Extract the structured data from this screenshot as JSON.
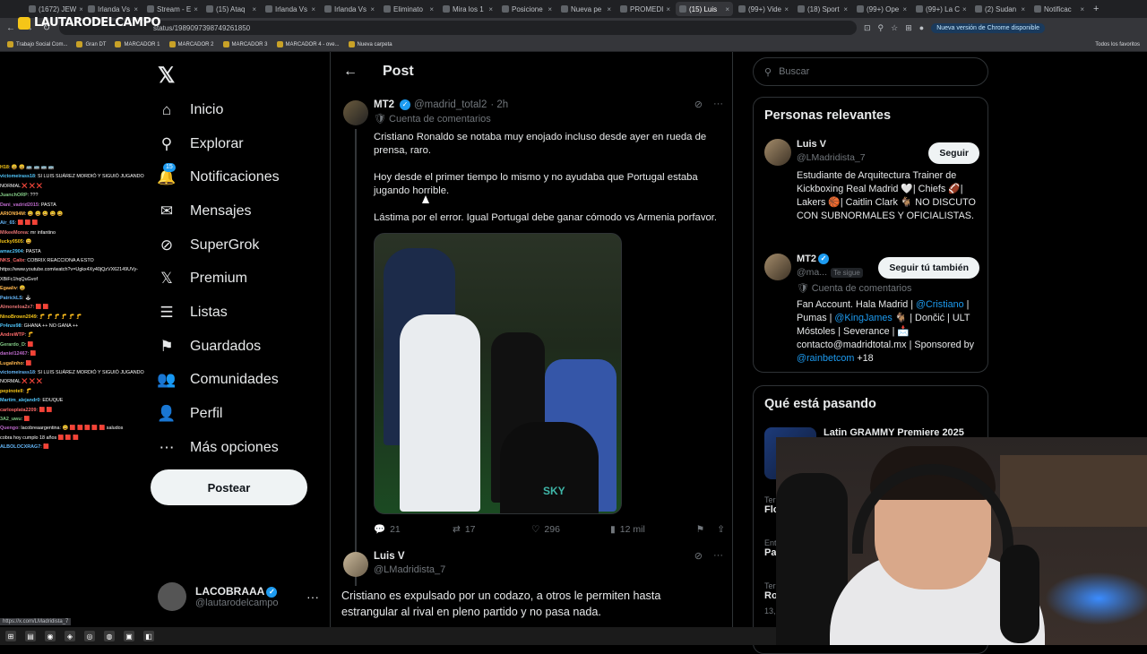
{
  "browser": {
    "tabs": [
      "(1672) JEW",
      "Irlanda Vs",
      "Stream - E",
      "(15) Ataq",
      "Irlanda Vs",
      "Irlanda Vs",
      "Eliminato",
      "Mira los 1",
      "Posicione",
      "Nueva pe",
      "PROMEDI",
      "(15) Luis",
      "(99+) Vide",
      "(18) Sport",
      "(99+) Ope",
      "(99+) La C",
      "(2) Sudan",
      "Notificac"
    ],
    "active_tab_index": 11,
    "url": "status/1989097398749261850",
    "update_label": "Nueva versión de Chrome disponible",
    "bookmarks": [
      "Trabajo Social Com...",
      "Gran DT",
      "MARCADOR 1",
      "MARCADOR 2",
      "MARCADOR 3",
      "MARCADOR 4 - ove...",
      "Nueva carpeta"
    ],
    "all_bookmarks": "Todos los favoritos",
    "status_url": "https://x.com/LMadridista_7"
  },
  "stream": {
    "logo": "LAUTARODELCAMPO",
    "chat": [
      {
        "user": "H18",
        "msg": ": 😀 😀 🚌 🚌 🚌 🚌"
      },
      {
        "user": "victomeirass18",
        "msg": ": SI LUIS SUÁREZ MORDIÓ Y SIGUIÓ JUGANDO"
      },
      {
        "user": "",
        "msg": "NORMAL ❌ ❌ ❌"
      },
      {
        "user": "JuanchORP",
        "msg": ": ???"
      },
      {
        "user": "Dani_vadrid2015",
        "msg": ": PASTA"
      },
      {
        "user": "ARION94M",
        "msg": ": 😀 😀 😀 😀 😀"
      },
      {
        "user": "Air_65",
        "msg": ": 🟥 🟥 🟥"
      },
      {
        "user": "MikeeMorea",
        "msg": ": mr infantino"
      },
      {
        "user": "lucky0505",
        "msg": ": 😀"
      },
      {
        "user": "amac2904",
        "msg": ": PASTA"
      },
      {
        "user": "NKS_Calix",
        "msg": ": COBRIX REACCIONA A ESTO"
      },
      {
        "user": "",
        "msg": "https://www.youtube.com/watch?v=Ugkx4Xy40jQzVX62149UVy-"
      },
      {
        "user": "",
        "msg": "XBiFc1hqQuGvof"
      },
      {
        "user": "Egaaliv",
        "msg": ": 😀"
      },
      {
        "user": "PatrickLS",
        "msg": ": 🕹"
      },
      {
        "user": "Almoneloa2x7",
        "msg": ": 🟥 🟥"
      },
      {
        "user": "NinoBrown2049",
        "msg": ": 🦵 🦵 🦵 🦵 🦵 🦵"
      },
      {
        "user": "Pr4nze98",
        "msg": ": GHANA ++ NO GANA ++"
      },
      {
        "user": "AndreWTP",
        "msg": ": 🦵"
      },
      {
        "user": "Gerardo_D",
        "msg": ": 🟥"
      },
      {
        "user": "daniel12467",
        "msg": ": 🟥"
      },
      {
        "user": "Lugalinho",
        "msg": ": 🟥"
      },
      {
        "user": "victomeirass18",
        "msg": ": SI LUIS SUÁREZ MORDIÓ Y SIGUIÓ JUGANDO"
      },
      {
        "user": "",
        "msg": "NORMAL ❌ ❌ ❌"
      },
      {
        "user": "pepinotell",
        "msg": ": 🦵"
      },
      {
        "user": "Martim_alejandr0",
        "msg": ": EDUQUE"
      },
      {
        "user": "carlosplata2209",
        "msg": ": 🟥 🟥"
      },
      {
        "user": "3A2_uwu",
        "msg": ": 🟥"
      },
      {
        "user": "Quengo",
        "msg": ": lacobreaargentina: 😀 🟥 🟥 🟥 🟥 🟥 saludos"
      },
      {
        "user": "",
        "msg": "cobra hoy cumplo 18 años 🟥 🟥 🟥"
      },
      {
        "user": "ALBOLOCXRAG7",
        "msg": ": 🟥"
      }
    ]
  },
  "sidebar": {
    "nav": [
      {
        "label": "Inicio",
        "icon": "home-icon",
        "glyph": "⌂"
      },
      {
        "label": "Explorar",
        "icon": "search-icon",
        "glyph": "⚲"
      },
      {
        "label": "Notificaciones",
        "icon": "bell-icon",
        "glyph": "🔔",
        "badge": "15"
      },
      {
        "label": "Mensajes",
        "icon": "mail-icon",
        "glyph": "✉"
      },
      {
        "label": "SuperGrok",
        "icon": "grok-icon",
        "glyph": "⊘"
      },
      {
        "label": "Premium",
        "icon": "x-premium-icon",
        "glyph": "𝕏"
      },
      {
        "label": "Listas",
        "icon": "list-icon",
        "glyph": "☰"
      },
      {
        "label": "Guardados",
        "icon": "bookmark-icon",
        "glyph": "⚑"
      },
      {
        "label": "Comunidades",
        "icon": "communities-icon",
        "glyph": "👥"
      },
      {
        "label": "Perfil",
        "icon": "profile-icon",
        "glyph": "👤"
      },
      {
        "label": "Más opciones",
        "icon": "more-circle-icon",
        "glyph": "⋯"
      }
    ],
    "post_button": "Postear",
    "account_name": "LACOBRAAA",
    "account_handle": "@lautarodelcampo"
  },
  "main": {
    "title": "Post",
    "tweet": {
      "name": "MT2",
      "handle": "@madrid_total2",
      "time": "· 2h",
      "sub": "Cuenta de comentarios",
      "paragraphs": [
        "Cristiano Ronaldo se notaba muy enojado incluso desde ayer en rueda de prensa, raro.",
        "Hoy desde el primer tiempo lo mismo y no ayudaba que Portugal estaba jugando horrible.",
        "Lástima por el error. Igual Portugal debe ganar cómodo vs Armenia porfavor."
      ],
      "image_label": "SKY",
      "replies": "21",
      "reposts": "17",
      "likes": "296",
      "views": "12 mil"
    },
    "reply": {
      "name": "Luis V",
      "handle": "@LMadridista_7",
      "text": "Cristiano es expulsado por un codazo, a otros le permiten hasta estrangular al rival en pleno partido y no pasa nada."
    }
  },
  "right": {
    "search_placeholder": "Buscar",
    "relevant_title": "Personas relevantes",
    "people": [
      {
        "name": "Luis V",
        "handle": "@LMadridista_7",
        "button": "Seguir",
        "bio": "Estudiante de Arquitectura Trainer de Kickboxing Real Madrid 🤍| Chiefs 🏈| Lakers 🏀| Caitlin Clark 🐐 NO DISCUTO CON SUBNORMALES Y OFICIALISTAS."
      },
      {
        "name": "MT2",
        "handle": "@ma...",
        "follows_you": "Te sigue",
        "button": "Seguir tú también",
        "sub": "Cuenta de comentarios",
        "bio_parts": [
          "Fan Account. Hala Madrid | ",
          "@Cristiano",
          " | Pumas | ",
          "@KingJames",
          " 🐐 | Dončić | ULT Móstoles | Severance | 📩 contacto@madridtotal.mx | Sponsored by ",
          "@rainbetcom",
          " +18"
        ]
      }
    ],
    "trending_title": "Qué está pasando",
    "trend_headline": "Latin GRAMMY Premiere 2025",
    "trend_side": [
      {
        "top": "Ter",
        "main": "Flo"
      },
      {
        "top": "Ent",
        "main": "Pa"
      },
      {
        "top": "Ter",
        "main": "Ro"
      },
      {
        "top": "13,",
        "main": ""
      }
    ]
  }
}
